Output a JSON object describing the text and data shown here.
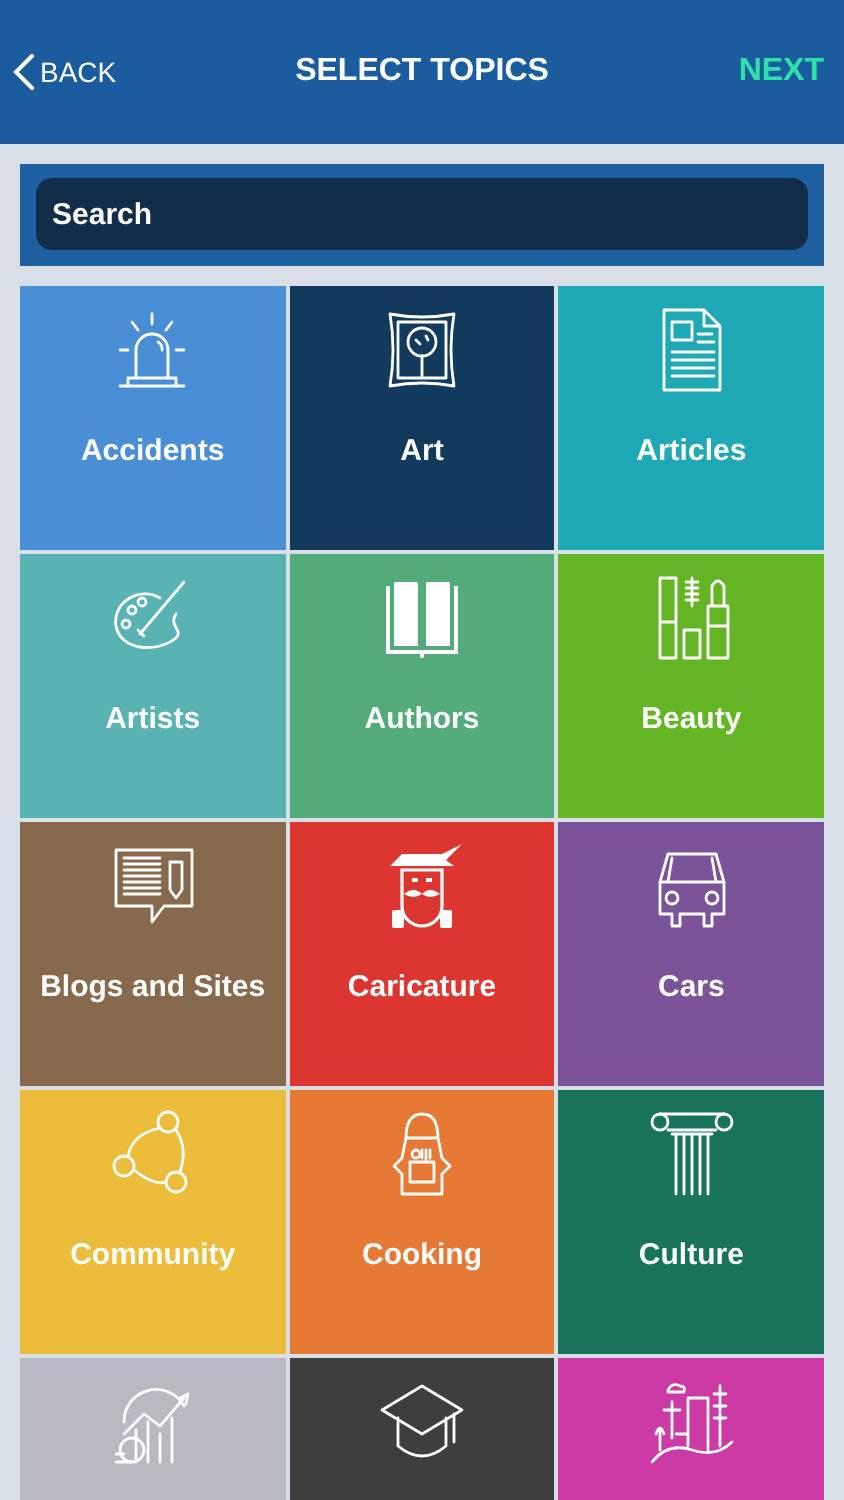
{
  "header": {
    "back": "BACK",
    "title": "SELECT TOPICS",
    "next": "NEXT"
  },
  "search": {
    "placeholder": "Search"
  },
  "tiles": [
    {
      "label": "Accidents",
      "color": "#4a8ed6"
    },
    {
      "label": "Art",
      "color": "#123a5c"
    },
    {
      "label": "Articles",
      "color": "#1fa9b6"
    },
    {
      "label": "Artists",
      "color": "#5ab3b3"
    },
    {
      "label": "Authors",
      "color": "#53ab7a"
    },
    {
      "label": "Beauty",
      "color": "#63b524"
    },
    {
      "label": "Blogs and Sites",
      "color": "#876a4d"
    },
    {
      "label": "Caricature",
      "color": "#dd3530"
    },
    {
      "label": "Cars",
      "color": "#7a5399"
    },
    {
      "label": "Community",
      "color": "#ecbd3b"
    },
    {
      "label": "Cooking",
      "color": "#e67a35"
    },
    {
      "label": "Culture",
      "color": "#19735a"
    },
    {
      "color": "#b7bac1"
    },
    {
      "color": "#3e3e3e"
    },
    {
      "color": "#cc3aa5"
    }
  ]
}
